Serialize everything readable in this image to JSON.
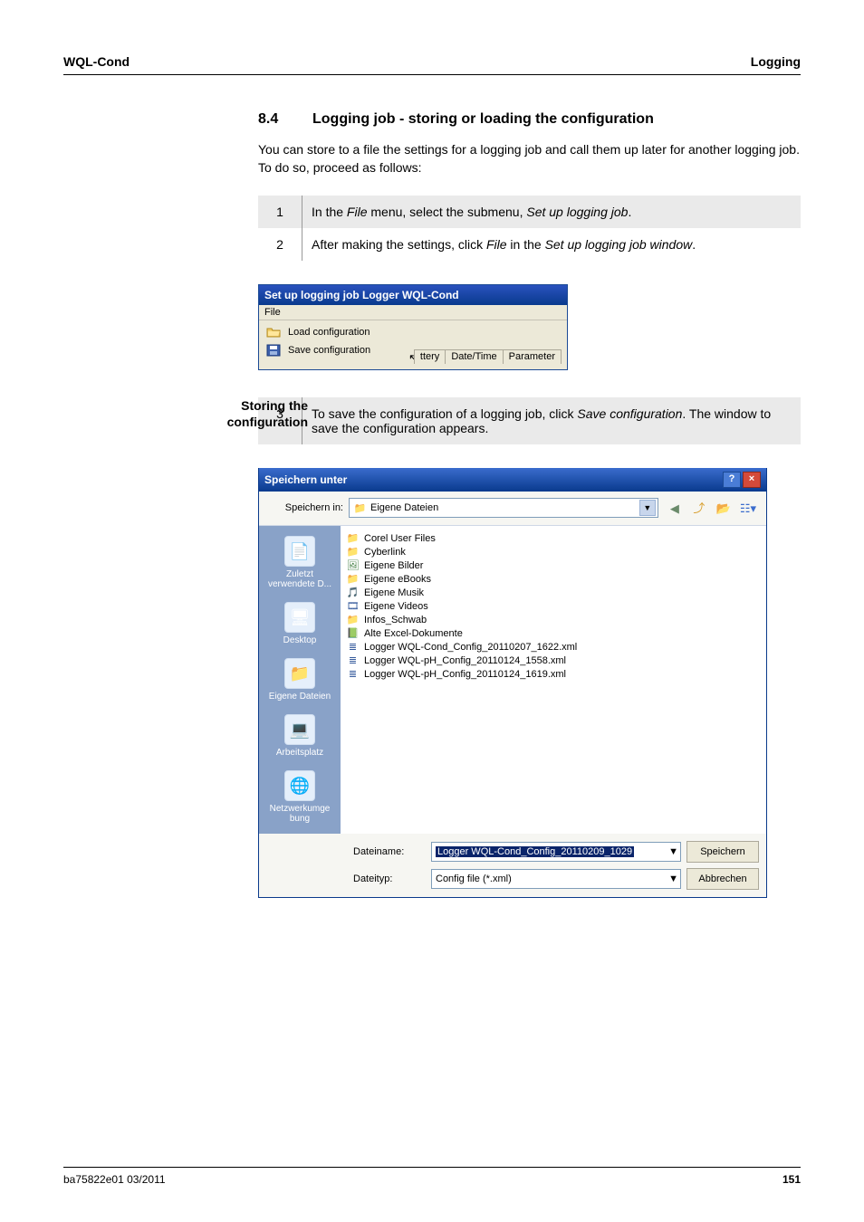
{
  "header": {
    "left": "WQL-Cond",
    "right": "Logging"
  },
  "section": {
    "number": "8.4",
    "title": "Logging job - storing or loading the configuration"
  },
  "intro": "You can store to a file the settings for a logging job and call them up later for another logging job. To do so, proceed as follows:",
  "steps_a": [
    {
      "n": "1",
      "pre": "In the ",
      "i1": "File",
      "mid": " menu, select the submenu, ",
      "i2": "Set up logging job",
      "post": "."
    },
    {
      "n": "2",
      "pre": "After making the settings, click ",
      "i1": "File",
      "mid": " in the ",
      "i2": "Set up logging job window",
      "post": "."
    }
  ],
  "win1": {
    "title": "Set up logging job Logger WQL-Cond",
    "file_menu": "File",
    "items": {
      "load": "Load configuration",
      "save": "Save configuration"
    },
    "tabs": {
      "ttery": "ttery",
      "datetime": "Date/Time",
      "parameter": "Parameter"
    }
  },
  "side_label_1": "Storing the",
  "side_label_2": "configuration",
  "steps_b": [
    {
      "n": "3",
      "pre": "To save the configuration of a logging job, click ",
      "i1": "Save configuration",
      "post": ". The window to save the configuration appears."
    }
  ],
  "dlg": {
    "title": "Speichern unter",
    "lookin_label": "Speichern in:",
    "lookin_value": "Eigene Dateien",
    "places": [
      {
        "label1": "Zuletzt",
        "label2": "verwendete D...",
        "glyph": "📄"
      },
      {
        "label1": "Desktop",
        "label2": "",
        "glyph": "🖥"
      },
      {
        "label1": "Eigene Dateien",
        "label2": "",
        "glyph": "📁"
      },
      {
        "label1": "Arbeitsplatz",
        "label2": "",
        "glyph": "💻"
      },
      {
        "label1": "Netzwerkumge",
        "label2": "bung",
        "glyph": "🌐"
      }
    ],
    "files": [
      {
        "icon": "folder",
        "name": "Corel User Files"
      },
      {
        "icon": "folder",
        "name": "Cyberlink"
      },
      {
        "icon": "imgf",
        "name": "Eigene Bilder"
      },
      {
        "icon": "folder",
        "name": "Eigene eBooks"
      },
      {
        "icon": "musf",
        "name": "Eigene Musik"
      },
      {
        "icon": "vidf",
        "name": "Eigene Videos"
      },
      {
        "icon": "folder",
        "name": "Infos_Schwab"
      },
      {
        "icon": "excf",
        "name": "Alte Excel-Dokumente"
      },
      {
        "icon": "xmlf",
        "name": "Logger WQL-Cond_Config_20110207_1622.xml"
      },
      {
        "icon": "xmlf",
        "name": "Logger WQL-pH_Config_20110124_1558.xml"
      },
      {
        "icon": "xmlf",
        "name": "Logger WQL-pH_Config_20110124_1619.xml"
      }
    ],
    "filename_label": "Dateiname:",
    "filename_value": "Logger WQL-Cond_Config_20110209_1029",
    "filetype_label": "Dateityp:",
    "filetype_value": "Config file (*.xml)",
    "save_btn": "Speichern",
    "cancel_btn": "Abbrechen"
  },
  "footer": {
    "left": "ba75822e01      03/2011",
    "right": "151"
  }
}
